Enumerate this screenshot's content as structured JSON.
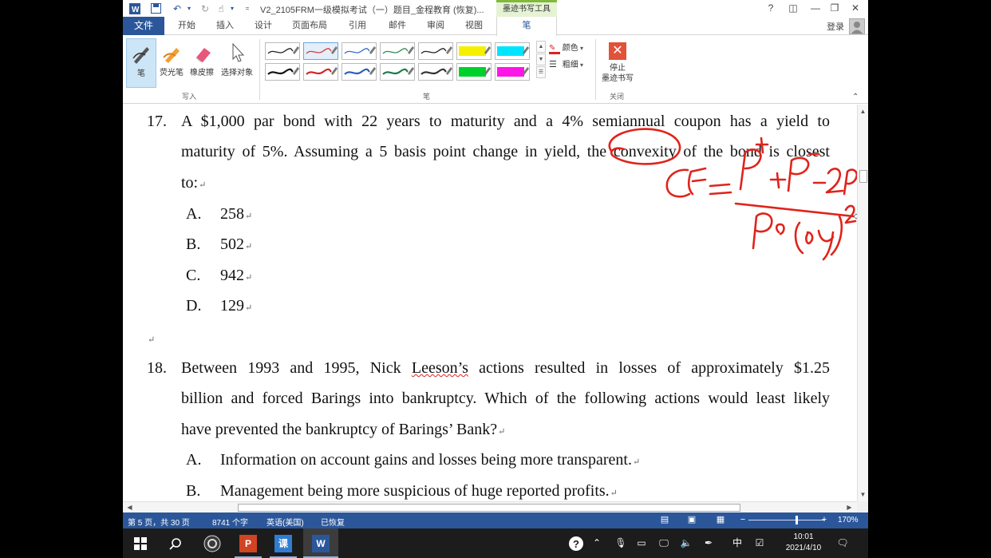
{
  "app": {
    "title": "V2_2105FRM一级模拟考试（一）题目_金程教育 (恢复)...",
    "context_tab_title": "墨迹书写工具",
    "quick_access": {
      "save_icon": "save-icon",
      "undo_icon": "undo-icon",
      "redo_icon": "redo-icon",
      "touch_icon": "touch-mode-icon",
      "more": "▾"
    },
    "window_controls": {
      "help": "?",
      "ribbon_display": "◫",
      "minimize": "—",
      "restore": "❐",
      "close": "✕"
    }
  },
  "tabs": {
    "file": "文件",
    "items": [
      "开始",
      "插入",
      "设计",
      "页面布局",
      "引用",
      "邮件",
      "审阅",
      "视图",
      "笔"
    ],
    "active": "笔",
    "login": "登录"
  },
  "ribbon": {
    "write_group": {
      "label": "写入",
      "buttons": [
        {
          "label": "笔",
          "icon": "pen-icon"
        },
        {
          "label": "荧光笔",
          "icon": "highlighter-icon"
        },
        {
          "label": "橡皮擦",
          "icon": "eraser-icon"
        },
        {
          "label": "选择对象",
          "icon": "select-objects-icon"
        }
      ]
    },
    "pens_group": {
      "label": "笔",
      "row1_colors": [
        "#222222",
        "#d83b3b",
        "#3a6ec0",
        "#2e8b57",
        "#222222",
        "#f6f000",
        "#00e5ff"
      ],
      "row2_colors": [
        "#111111",
        "#d82222",
        "#2a5fb8",
        "#1c7a48",
        "#333333",
        "#00d12a",
        "#ff14e8"
      ],
      "selected_index": 1,
      "color_label": "颜色",
      "thickness_label": "粗细"
    },
    "close_group": {
      "label": "关闭",
      "stop_label_1": "停止",
      "stop_label_2": "墨迹书写"
    }
  },
  "document": {
    "q17": {
      "number": "17.",
      "line1": "A $1,000 par bond with 22 years to maturity and a 4% semiannual coupon has a yield to",
      "line2": "maturity of 5%. Assuming a 5 basis point change in yield, the convexity of the bond is closest",
      "line3": "to:",
      "options": [
        {
          "letter": "A.",
          "text": "258"
        },
        {
          "letter": "B.",
          "text": "502"
        },
        {
          "letter": "C.",
          "text": "942"
        },
        {
          "letter": "D.",
          "text": "129"
        }
      ]
    },
    "q18": {
      "number": "18.",
      "line1_a": "Between 1993 and 1995, Nick ",
      "line1_b": "Leeson’s",
      "line1_c": " actions resulted in losses of approximately $1.25",
      "line2": "billion and forced Barings into bankruptcy. Which of the following actions would least likely",
      "line3": "have prevented the bankruptcy of Barings’ Bank?",
      "options": [
        {
          "letter": "A.",
          "text": "Information on account gains and losses being more transparent."
        },
        {
          "letter": "B.",
          "text": "Management being more suspicious of huge reported profits."
        }
      ]
    },
    "paragraph_mark": "↵",
    "ink_annotation": "handwritten convexity formula: CE = (P+ + P- - 2P0) / (P0 (Δy)^2)"
  },
  "status_bar": {
    "page": "第 5 页，共 30 页",
    "words": "8741 个字",
    "language": "英语(美国)",
    "recovered": "已恢复",
    "zoom": "170%",
    "zoom_fraction": 0.62
  },
  "taskbar": {
    "apps": [
      "start-icon",
      "search-icon",
      "obs-icon",
      "powerpoint-icon",
      "classroom-app-icon",
      "word-icon"
    ],
    "app_letters": {
      "powerpoint": "P",
      "word": "W"
    },
    "ime": "中",
    "time": "10:01",
    "date": "2021/4/10"
  }
}
